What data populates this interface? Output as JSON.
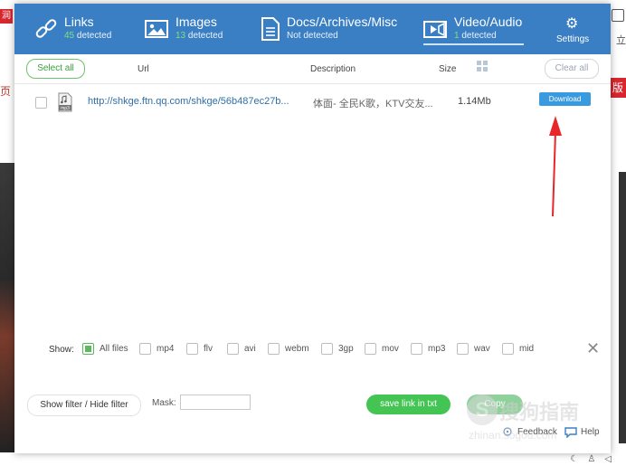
{
  "background": {
    "left_badge": "润",
    "left_text": "页",
    "right_text": "立",
    "right_badge": "版"
  },
  "tabs": [
    {
      "name": "Links",
      "count": "45",
      "count_suffix": "detected",
      "icon": "link-icon"
    },
    {
      "name": "Images",
      "count": "13",
      "count_suffix": "detected",
      "icon": "image-icon"
    },
    {
      "name": "Docs/Archives/Misc",
      "status": "Not detected",
      "icon": "document-icon"
    },
    {
      "name": "Video/Audio",
      "count": "1",
      "count_suffix": "detected",
      "icon": "video-icon",
      "active": true
    }
  ],
  "settings": {
    "label": "Settings",
    "icon": "gear-icon"
  },
  "table": {
    "select_all": "Select all",
    "clear_all": "Clear all",
    "columns": {
      "url": "Url",
      "description": "Description",
      "size": "Size"
    },
    "rows": [
      {
        "file_type": "mp3",
        "url": "http://shkge.ftn.qq.com/shkge/56b487ec27b...",
        "description": "体面- 全民K歌，KTV交友...",
        "size": "1.14Mb",
        "action": "Download"
      }
    ]
  },
  "filter": {
    "label": "Show:",
    "options": [
      {
        "label": "All files",
        "checked": true
      },
      {
        "label": "mp4",
        "checked": false
      },
      {
        "label": "flv",
        "checked": false
      },
      {
        "label": "avi",
        "checked": false
      },
      {
        "label": "webm",
        "checked": false
      },
      {
        "label": "3gp",
        "checked": false
      },
      {
        "label": "mov",
        "checked": false
      },
      {
        "label": "mp3",
        "checked": false
      },
      {
        "label": "wav",
        "checked": false
      },
      {
        "label": "mid",
        "checked": false
      }
    ]
  },
  "bottom": {
    "show_filter": "Show filter / Hide filter",
    "mask_label": "Mask:",
    "mask_value": "",
    "save_link": "save link in txt",
    "copy": "Copy",
    "feedback": "Feedback",
    "help": "Help"
  },
  "watermark": {
    "cn": "搜狗指南",
    "en": "zhinan.sogou.com"
  },
  "colors": {
    "header_bg": "#3a7fc4",
    "count_green": "#7ee07e",
    "save_green": "#44c553",
    "download_blue": "#3a9ae0",
    "arrow_red": "#e8262a"
  }
}
